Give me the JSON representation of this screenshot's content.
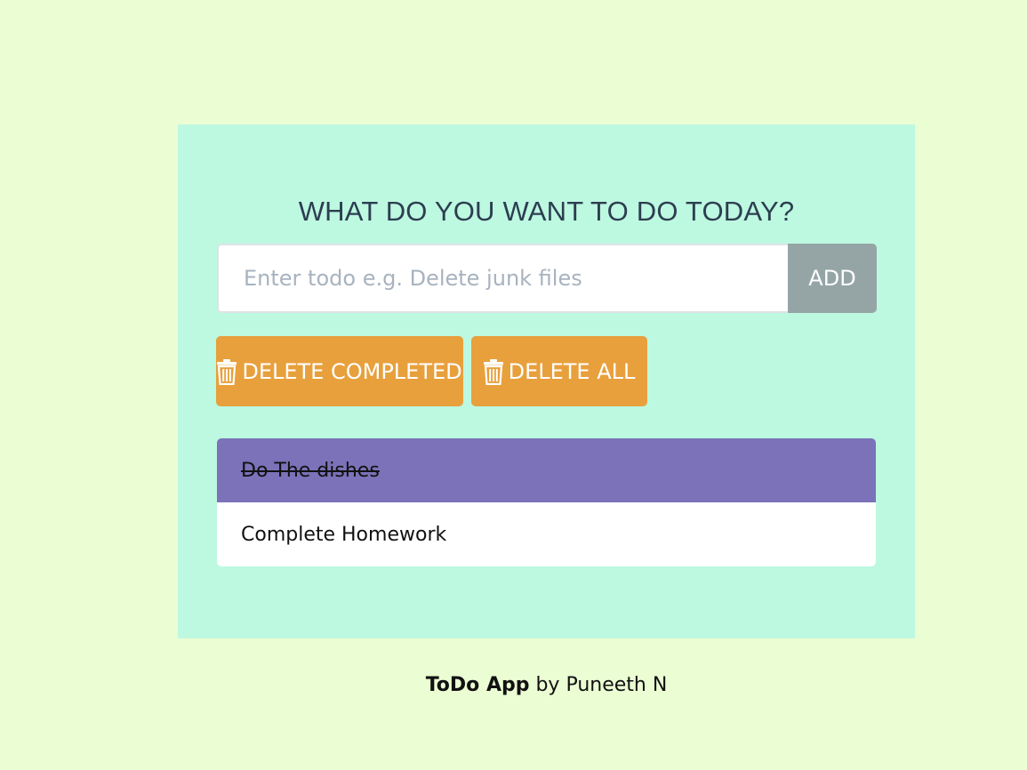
{
  "app": {
    "heading": "WHAT DO YOU WANT TO DO TODAY?"
  },
  "form": {
    "input_value": "",
    "input_placeholder": "Enter todo e.g. Delete junk files",
    "add_label": "ADD"
  },
  "actions": {
    "delete_completed_label": "DELETE COMPLETED",
    "delete_all_label": "DELETE ALL",
    "icon": "trash-icon"
  },
  "todos": [
    {
      "text": "Do The dishes",
      "completed": true
    },
    {
      "text": "Complete Homework",
      "completed": false
    }
  ],
  "footer": {
    "brand": "ToDo App",
    "byline": " by Puneeth N"
  },
  "colors": {
    "page_bg": "#ebfdd3",
    "card_bg": "#bdf8e1",
    "accent_orange": "#e8a03c",
    "add_button": "#95a5a6",
    "completed_item": "#7b72b9"
  }
}
